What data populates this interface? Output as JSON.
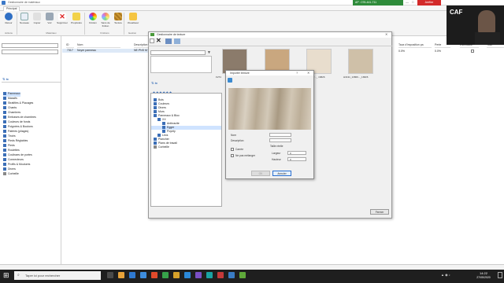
{
  "window": {
    "title": "Gestionnaire de matériaux"
  },
  "status": {
    "account": "AP : 076-441-711",
    "leave_button": "Arrêter"
  },
  "tabs": [
    "Principal"
  ],
  "ribbon": {
    "buttons": [
      "Retour",
      "Nouveau",
      "Copier",
      "Voir",
      "Supprimer",
      "Propriétés",
      "Finition",
      "Sans de finition",
      "Texture",
      "Visualiseur"
    ],
    "groups": [
      "Actions",
      "Matériaux",
      "Finitions",
      "Gestion"
    ]
  },
  "left_tree": {
    "items": [
      "Panneaux",
      "Massifs",
      "Stratifiés & Placages",
      "Chants",
      "Chambres",
      "Embases de chambres",
      "Couleurs de fonds",
      "Poignées & Boutons",
      "Patères (pliages)",
      "Tiroirs",
      "Pieds Réglables",
      "Pieds",
      "Roulettes",
      "Coulisses de portes",
      "Connecteurs",
      "Profils & Moulures",
      "Divers",
      "Corbeille"
    ]
  },
  "grid": {
    "columns": [
      "ID",
      "Nom",
      "Description"
    ],
    "row": {
      "id": "7317",
      "name": "Noyer panneau",
      "desc": "NE.PNS M"
    },
    "right_columns": [
      "Taux d'imposition pa",
      "Perte",
      "Estimation",
      "Tolér"
    ],
    "right_values": [
      "0.0%",
      "0.0%"
    ]
  },
  "dialog": {
    "title": "Gestionnaire de texture",
    "textures": [
      {
        "label": "F274",
        "color": "#8b7b6b"
      },
      {
        "label": "",
        "color": "#c9a77f"
      },
      {
        "label": "H3060_W..._ 16826",
        "color": "#e8ddcd"
      },
      {
        "label": "H3131_13806..._16826",
        "color": "#cfc0a8"
      }
    ],
    "tree": [
      "Bois",
      "Couleurs",
      "Divers",
      "Murs",
      "Panneaux & Bloc",
      "XX",
      "Anthracite",
      "Egger",
      "Poyety",
      "Lecs",
      "Plancher",
      "Plans de travail",
      "Corbeille"
    ],
    "close_button": "Fermer"
  },
  "import_dialog": {
    "title": "Importer texture",
    "name_label": "Nom",
    "desc_label": "Description",
    "square_label": "Carrée",
    "noblend_label": "Ne pas mélanger",
    "size_label": "Taille réelle",
    "width_label": "Largeur",
    "height_label": "Hauteur",
    "width_value": "0",
    "height_value": "0",
    "ok": "OK",
    "cancel": "Annuler"
  },
  "taskbar": {
    "search": "Taper ici pour rechercher",
    "time": "14:22",
    "date": "27/05/2020"
  }
}
